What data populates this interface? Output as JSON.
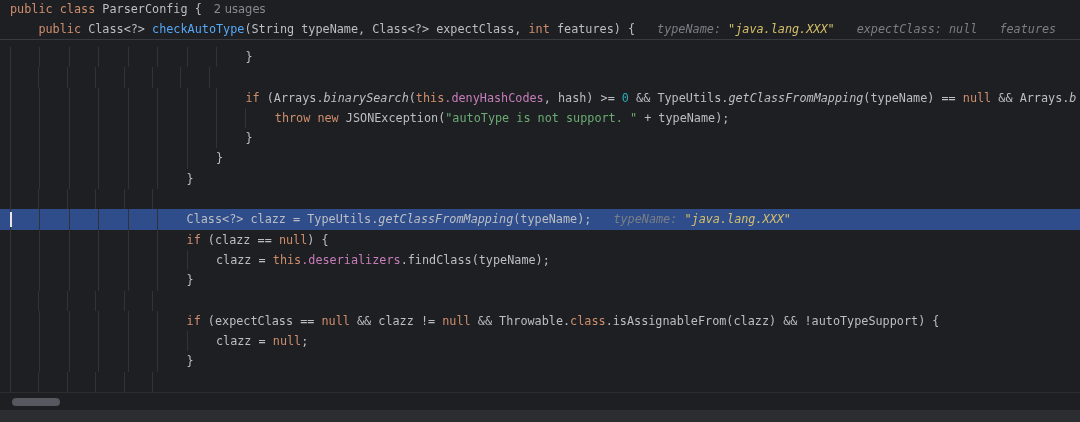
{
  "header": [
    {
      "tokens": [
        {
          "kind": "kw",
          "text": "public class "
        },
        {
          "kind": "id",
          "text": "ParserConfig {"
        }
      ],
      "usages": "2 usages"
    },
    {
      "tokens": [
        {
          "kind": "kw",
          "text": "    public "
        },
        {
          "kind": "id",
          "text": "Class<?> "
        },
        {
          "kind": "decl",
          "text": "checkAutoType"
        },
        {
          "kind": "id",
          "text": "(String typeName, Class<?> expectClass, "
        },
        {
          "kind": "kw",
          "text": "int "
        },
        {
          "kind": "id",
          "text": "features) {"
        }
      ],
      "values": [
        {
          "label": "typeName: ",
          "value": "\"java.lang.XXX\"",
          "kind": "string"
        },
        {
          "label": "expectClass: ",
          "value": "null",
          "kind": "plain"
        },
        {
          "label": "features"
        }
      ]
    }
  ],
  "lines": [
    {
      "kind": "code",
      "selected": false,
      "tokens": [
        {
          "kind": "id",
          "text": "                                }"
        }
      ]
    },
    {
      "kind": "blank",
      "selected": false
    },
    {
      "kind": "code",
      "selected": false,
      "tokens": [
        {
          "kind": "kw",
          "text": "                                if "
        },
        {
          "kind": "id",
          "text": "(Arrays."
        },
        {
          "kind": "static",
          "text": "binarySearch"
        },
        {
          "kind": "id",
          "text": "("
        },
        {
          "kind": "kw",
          "text": "this"
        },
        {
          "kind": "field",
          "text": ".denyHashCodes"
        },
        {
          "kind": "id",
          "text": ", hash) >= "
        },
        {
          "kind": "num",
          "text": "0"
        },
        {
          "kind": "id",
          "text": " && TypeUtils."
        },
        {
          "kind": "static",
          "text": "getClassFromMapping"
        },
        {
          "kind": "id",
          "text": "(typeName) == "
        },
        {
          "kind": "kw",
          "text": "null"
        },
        {
          "kind": "id",
          "text": " && Arrays."
        },
        {
          "kind": "static",
          "text": "b"
        }
      ]
    },
    {
      "kind": "code",
      "selected": false,
      "tokens": [
        {
          "kind": "kw",
          "text": "                                    throw new "
        },
        {
          "kind": "id",
          "text": "JSONException("
        },
        {
          "kind": "str",
          "text": "\"autoType is not support. \""
        },
        {
          "kind": "id",
          "text": " + typeName);"
        }
      ]
    },
    {
      "kind": "code",
      "selected": false,
      "tokens": [
        {
          "kind": "id",
          "text": "                                }"
        }
      ]
    },
    {
      "kind": "code",
      "selected": false,
      "tokens": [
        {
          "kind": "id",
          "text": "                            }"
        }
      ]
    },
    {
      "kind": "code",
      "selected": false,
      "tokens": [
        {
          "kind": "id",
          "text": "                        }"
        }
      ]
    },
    {
      "kind": "blank",
      "selected": false
    },
    {
      "kind": "code",
      "selected": true,
      "tokens": [
        {
          "kind": "id",
          "text": "                        Class<?> clazz = TypeUtils."
        },
        {
          "kind": "static",
          "text": "getClassFromMapping"
        },
        {
          "kind": "id",
          "text": "(typeName);"
        }
      ],
      "values": [
        {
          "label": "typeName: ",
          "value": "\"java.lang.XXX\"",
          "kind": "string"
        }
      ]
    },
    {
      "kind": "code",
      "selected": false,
      "tokens": [
        {
          "kind": "kw",
          "text": "                        if "
        },
        {
          "kind": "id",
          "text": "(clazz == "
        },
        {
          "kind": "kw",
          "text": "null"
        },
        {
          "kind": "id",
          "text": ") {"
        }
      ]
    },
    {
      "kind": "code",
      "selected": false,
      "tokens": [
        {
          "kind": "id",
          "text": "                            clazz = "
        },
        {
          "kind": "kw",
          "text": "this"
        },
        {
          "kind": "field",
          "text": ".deserializers"
        },
        {
          "kind": "id",
          "text": ".findClass(typeName);"
        }
      ]
    },
    {
      "kind": "code",
      "selected": false,
      "tokens": [
        {
          "kind": "id",
          "text": "                        }"
        }
      ]
    },
    {
      "kind": "blank",
      "selected": false
    },
    {
      "kind": "code",
      "selected": false,
      "tokens": [
        {
          "kind": "kw",
          "text": "                        if "
        },
        {
          "kind": "id",
          "text": "(expectClass == "
        },
        {
          "kind": "kw",
          "text": "null"
        },
        {
          "kind": "id",
          "text": " && clazz != "
        },
        {
          "kind": "kw",
          "text": "null"
        },
        {
          "kind": "id",
          "text": " && Throwable."
        },
        {
          "kind": "kw",
          "text": "class"
        },
        {
          "kind": "id",
          "text": ".isAssignableFrom(clazz) && !autoTypeSupport) {"
        }
      ]
    },
    {
      "kind": "code",
      "selected": false,
      "tokens": [
        {
          "kind": "id",
          "text": "                            clazz = "
        },
        {
          "kind": "kw",
          "text": "null"
        },
        {
          "kind": "id",
          "text": ";"
        }
      ]
    },
    {
      "kind": "code",
      "selected": false,
      "tokens": [
        {
          "kind": "id",
          "text": "                        }"
        }
      ]
    },
    {
      "kind": "blank",
      "selected": false
    }
  ]
}
